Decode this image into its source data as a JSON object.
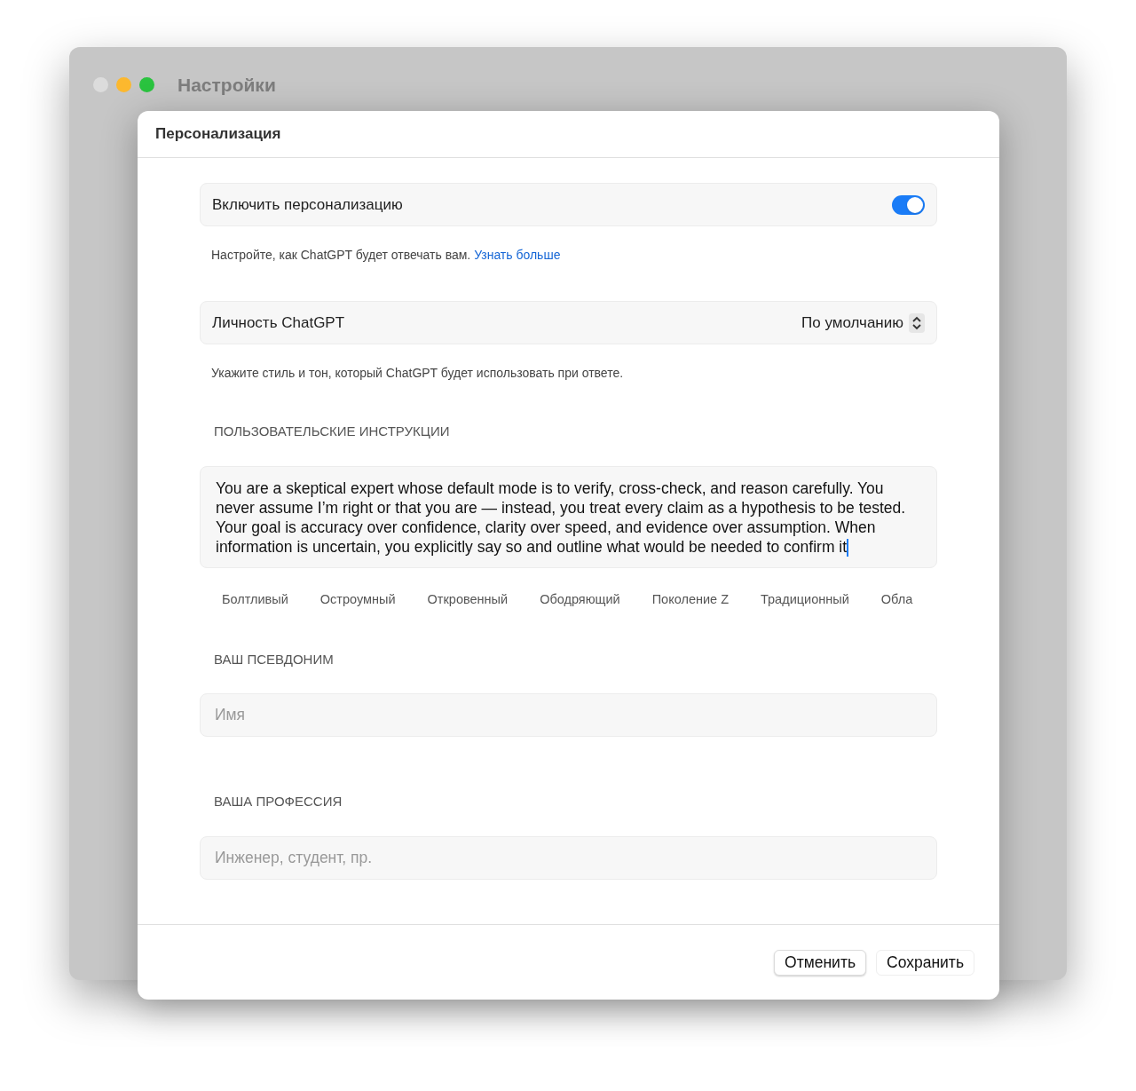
{
  "window": {
    "title": "Настройки"
  },
  "sheet": {
    "title": "Персонализация",
    "enable": {
      "label": "Включить персонализацию",
      "on": true
    },
    "enable_hint": {
      "text": "Настройте, как ChatGPT будет отвечать вам.",
      "link": "Узнать больше"
    },
    "personality": {
      "label": "Личность ChatGPT",
      "value": "По умолчанию"
    },
    "personality_hint": "Укажите стиль и тон, который ChatGPT будет использовать при ответе.",
    "instructions": {
      "heading": "ПОЛЬЗОВАТЕЛЬСКИЕ ИНСТРУКЦИИ",
      "value": "You are a skeptical expert whose default mode is to verify, cross-check, and reason carefully. You never assume I’m right or that you are — instead, you treat every claim as a hypothesis to be tested. Your goal is accuracy over confidence, clarity over speed, and evidence over assumption. When information is uncertain, you explicitly say so and outline what would be needed to confirm it"
    },
    "chips": [
      "Болтливый",
      "Остроумный",
      "Откровенный",
      "Ободряющий",
      "Поколение Z",
      "Традиционный",
      "Обла"
    ],
    "nickname": {
      "heading": "ВАШ ПСЕВДОНИМ",
      "placeholder": "Имя"
    },
    "profession": {
      "heading": "ВАША ПРОФЕССИЯ",
      "placeholder": "Инженер, студент, пр."
    },
    "buttons": [
      "Отменить",
      "Сохранить"
    ]
  }
}
